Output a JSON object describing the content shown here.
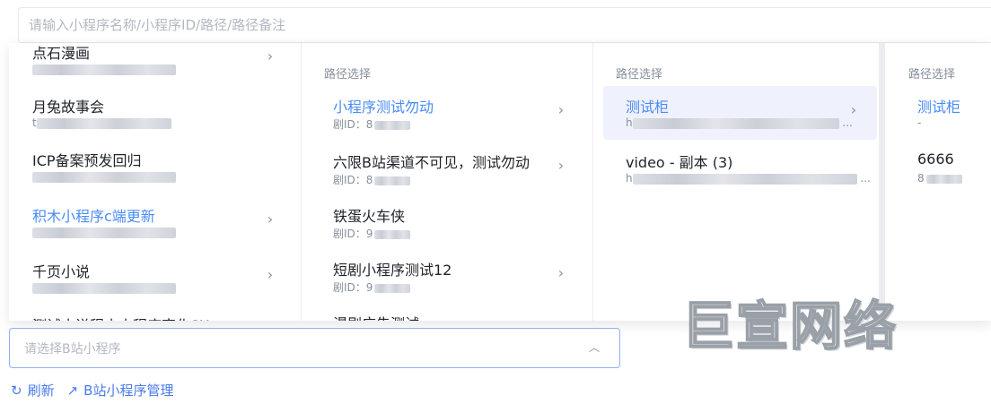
{
  "search": {
    "placeholder": "请输入小程序名称/小程序ID/路径/路径备注"
  },
  "cascader": {
    "col1": {
      "items": [
        {
          "title": "点石漫画",
          "has_children": true
        },
        {
          "title": "月兔故事会",
          "sub": "t",
          "has_children": false
        },
        {
          "title": "ICP备案预发回归",
          "has_children": false
        },
        {
          "title": "积木小程序c端更新",
          "active": true,
          "has_children": true
        },
        {
          "title": "千页小说",
          "has_children": true
        },
        {
          "title": "测试小说程小小程序变化SX"
        }
      ]
    },
    "col2": {
      "header": "路径选择",
      "items": [
        {
          "title": "小程序测试勿动",
          "sub": "剧ID：8",
          "active": true,
          "has_children": true
        },
        {
          "title": "六限B站渠道不可见，测试勿动",
          "sub": "剧ID：8",
          "has_children": true
        },
        {
          "title": "铁蛋火车侠",
          "sub": "剧ID：9",
          "has_children": false
        },
        {
          "title": "短剧小程序测试12",
          "sub": "剧ID：9",
          "has_children": true
        },
        {
          "title": "漫剧广告测试"
        }
      ]
    },
    "col3": {
      "header": "路径选择",
      "items": [
        {
          "title": "测试柜",
          "sub": "h",
          "active": true,
          "has_children": true
        },
        {
          "title": "video - 副本 (3)",
          "sub": "h",
          "has_children": false
        }
      ]
    },
    "col4": {
      "header": "路径选择",
      "items": [
        {
          "title": "测试柜",
          "sub": "-",
          "active": true
        },
        {
          "title": "6666",
          "sub": "8"
        }
      ]
    }
  },
  "select": {
    "placeholder": "请选择B站小程序"
  },
  "actions": {
    "refresh": "刷新",
    "manage": "B站小程序管理"
  },
  "watermark": "巨宣网络",
  "colors": {
    "accent": "#4a8cf6",
    "link": "#4a7be8",
    "active_bg": "#eff1fd"
  },
  "icons": {
    "chevron": "chevron-right-icon",
    "arrow_up": "chevron-up-icon",
    "refresh": "refresh-icon",
    "external": "external-link-icon"
  }
}
